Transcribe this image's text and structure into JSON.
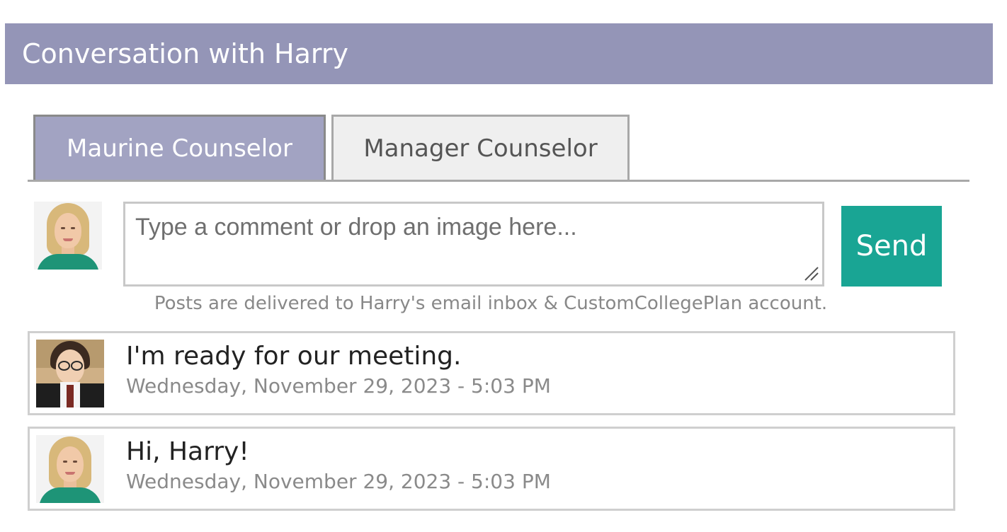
{
  "header": {
    "title": "Conversation with Harry"
  },
  "tabs": [
    {
      "label": "Maurine Counselor",
      "active": true
    },
    {
      "label": "Manager Counselor",
      "active": false
    }
  ],
  "composer": {
    "placeholder": "Type a comment or drop an image here...",
    "value": "",
    "send_label": "Send"
  },
  "notice": "Posts are delivered to Harry's email inbox & CustomCollegePlan account.",
  "messages": [
    {
      "text": "I'm ready for our meeting.",
      "time": "Wednesday, November 29, 2023 - 5:03 PM",
      "author_avatar": "student-avatar"
    },
    {
      "text": "Hi, Harry!",
      "time": "Wednesday, November 29, 2023 - 5:03 PM",
      "author_avatar": "counselor-avatar"
    }
  ],
  "colors": {
    "header_bg": "#9495b7",
    "active_tab_bg": "#a2a3c2",
    "send_button_bg": "#19a594"
  }
}
